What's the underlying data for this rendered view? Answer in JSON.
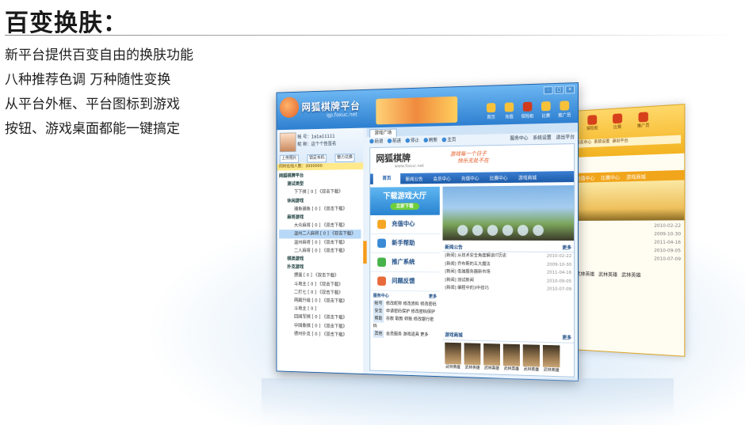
{
  "headline": "百变换肤：",
  "lines": [
    "新平台提供百变自由的换肤功能",
    "八种推荐色调 万种随性变换",
    "从平台外框、平台图标到游戏",
    "按钮、游戏桌面都能一键搞定"
  ],
  "window": {
    "brand": "网狐棋牌平台",
    "url": "qp.foxuc.net",
    "top_icons": [
      "首页",
      "充值",
      "保险柜",
      "比赛",
      "推广员"
    ],
    "controls": [
      "-",
      "□",
      "×"
    ],
    "user": {
      "id_label": "帐  号：",
      "id_value": "1a1a11111",
      "nick_label": "昵  称：",
      "nick_value": "这个个性签名",
      "buttons": [
        "上传照片",
        "锁定本机",
        "魅力兑换"
      ]
    },
    "online": "同时在线人数：3000000",
    "tree": [
      {
        "level": "g",
        "text": "网狐棋牌平台"
      },
      {
        "level": "l2",
        "text": "测试类型"
      },
      {
        "level": "l3",
        "text": "下下棋 [ 0 ] 《双击下载》"
      },
      {
        "level": "l2",
        "text": "休闲游戏"
      },
      {
        "level": "l3",
        "text": "捕鱼捕鱼 [ 0 ] 《双击下载》"
      },
      {
        "level": "l2",
        "text": "麻将游戏"
      },
      {
        "level": "l3",
        "text": "大众麻将 [ 0 ] 《双击下载》"
      },
      {
        "level": "l3sel",
        "text": "温州二人麻将 [ 0 ] 《双击下载》"
      },
      {
        "level": "l3",
        "text": "温州麻将 [ 0 ] 《双击下载》"
      },
      {
        "level": "l3",
        "text": "二人麻将 [ 0 ] 《双击下载》"
      },
      {
        "level": "l2",
        "text": "棋类游戏"
      },
      {
        "level": "l2",
        "text": "扑克游戏"
      },
      {
        "level": "l3",
        "text": "掼蛋 [ 0 ] 《双击下载》"
      },
      {
        "level": "l3",
        "text": "斗地主 [ 0 ] 《双击下载》"
      },
      {
        "level": "l3",
        "text": "二打七 [ 0 ] 《双击下载》"
      },
      {
        "level": "l3",
        "text": "两副升级 [ 0 ] 《双击下载》"
      },
      {
        "level": "l3",
        "text": "斗地主 [ 0 ]"
      },
      {
        "level": "l3",
        "text": "四国军棋 [ 0 ] 《双击下载》"
      },
      {
        "level": "l3",
        "text": "中国象棋 [ 0 ] 《双击下载》"
      },
      {
        "level": "l3",
        "text": "德州扑克 [ 0 ] 《双击下载》"
      }
    ],
    "tab": "游戏广场",
    "toolbar": [
      "后退",
      "前进",
      "停止",
      "刷新",
      "主页"
    ],
    "toolbar_right": [
      "服务中心",
      "系统设置",
      "退出平台"
    ],
    "page": {
      "brand": "网狐棋牌",
      "url": "www.foxuc.net",
      "slogan": [
        "游戏每一个日子",
        "快乐无处不在"
      ],
      "nav": [
        "首页",
        "新闻公告",
        "会员中心",
        "充值中心",
        "比赛中心",
        "游戏商城"
      ],
      "download_title": "下载游戏大厅",
      "download_btn": "立即下载",
      "menu": [
        "充值中心",
        "新手帮助",
        "推广系统",
        "问题反馈"
      ],
      "service_title": "服务中心",
      "more": "更多",
      "service_rows": [
        {
          "tag": "帐号",
          "text": "修改昵称  修改资料  修改密码"
        },
        {
          "tag": "安全",
          "text": "申请密码保护  修改密码保护"
        },
        {
          "tag": "帮助",
          "text": "存款  取款  转账  修改银行密码"
        },
        {
          "tag": "其他",
          "text": "会员服务  游戏道具  更多"
        }
      ],
      "news_title": "新闻公告",
      "news": [
        {
          "t": "[新闻] 从技术安全角度解读IT历史",
          "d": "2010-02-22"
        },
        {
          "t": "[新闻] 乔布斯的五大魔法",
          "d": "2009-10-30"
        },
        {
          "t": "[新闻] 低端服务器新市场",
          "d": "2011-04-16"
        },
        {
          "t": "[新闻] 测试新闻",
          "d": "2010-09-05"
        },
        {
          "t": "[新闻] 编程中的3中技巧",
          "d": "2010-07-09"
        }
      ],
      "mall_title": "游戏商城",
      "mall": [
        "武林英雄",
        "武林英雄",
        "武林英雄",
        "武林英雄",
        "武林英雄",
        "武林英雄"
      ]
    }
  },
  "back_window": {
    "top_icons": [
      "保险柜",
      "比赛",
      "推广员"
    ],
    "toolbar_right": [
      "服务中心",
      "系统设置",
      "退出平台"
    ],
    "nav": [
      "充值中心",
      "比赛中心",
      "游戏商城"
    ],
    "dates": [
      "2010-02-22",
      "2009-10-30",
      "2011-04-16",
      "2010-09-05",
      "2010-07-09"
    ],
    "mall": [
      "武林英雄",
      "武林英雄",
      "武林英雄"
    ]
  }
}
